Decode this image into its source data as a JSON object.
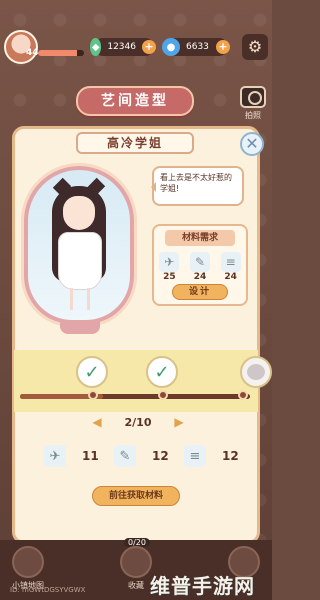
{
  "player": {
    "level": "44",
    "xp_fraction": 0.85
  },
  "currencies": [
    {
      "icon": "gem-icon",
      "value": "12346",
      "color": "#5ec48a"
    },
    {
      "icon": "crystal-icon",
      "value": "6633",
      "color": "#4ea6e8"
    }
  ],
  "header": {
    "title": "艺间造型",
    "photo_label": "拍照"
  },
  "character": {
    "name": "高冷学姐",
    "speech": "看上去是不太好惹的学姐!"
  },
  "materials": {
    "header": "材料需求",
    "items": [
      {
        "icon": "hairdryer-icon",
        "count": "25"
      },
      {
        "icon": "curling-iron-icon",
        "count": "24"
      },
      {
        "icon": "comb-icon",
        "count": "24"
      }
    ],
    "design_label": "设计"
  },
  "progress": {
    "current": 2,
    "total": 10,
    "page_text": "2/10",
    "fill_fraction": 0.36
  },
  "owned": [
    {
      "icon": "hairdryer-icon",
      "count": "11"
    },
    {
      "icon": "curling-iron-icon",
      "count": "12"
    },
    {
      "icon": "comb-icon",
      "count": "12"
    }
  ],
  "fetch_label": "前往获取材料",
  "bottom": {
    "counter": "0/20",
    "id_text": "ID: mGWtDGSYVGWX",
    "left_label": "小镇地图",
    "mid_label": "收藏",
    "watermark": "维普手游网"
  }
}
